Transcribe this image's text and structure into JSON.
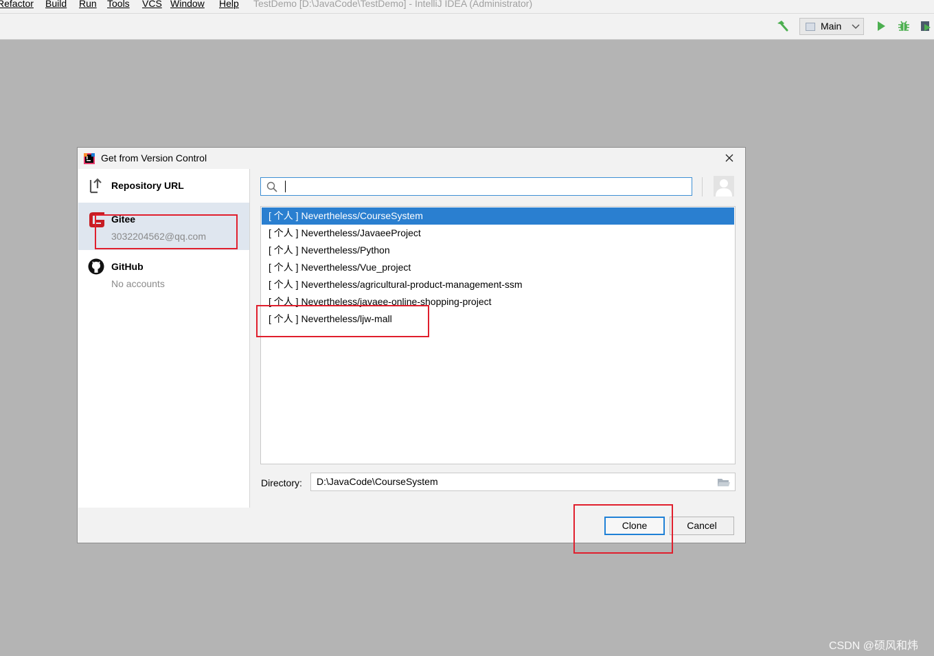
{
  "menubar": {
    "items": [
      "Refactor",
      "Build",
      "Run",
      "Tools",
      "VCS",
      "Window",
      "Help"
    ],
    "window_title": "TestDemo [D:\\JavaCode\\TestDemo] - IntelliJ IDEA (Administrator)"
  },
  "toolbar": {
    "build_icon": "hammer-icon",
    "run_config_label": "Main",
    "run_icon": "run-icon",
    "debug_icon": "debug-icon",
    "coverage_icon": "coverage-icon"
  },
  "dialog": {
    "title": "Get from Version Control",
    "sidebar": [
      {
        "label": "Repository URL",
        "sub": "",
        "icon": "vcs-branch-icon"
      },
      {
        "label": "Gitee",
        "sub": "3032204562@qq.com",
        "icon": "gitee-icon",
        "selected": true
      },
      {
        "label": "GitHub",
        "sub": "No accounts",
        "icon": "github-icon"
      }
    ],
    "search": {
      "value": "",
      "placeholder": ""
    },
    "repos": [
      {
        "tag": "[ 个人 ]",
        "name": "Nevertheless/CourseSystem",
        "selected": true
      },
      {
        "tag": "[ 个人 ]",
        "name": "Nevertheless/JavaeeProject"
      },
      {
        "tag": "[ 个人 ]",
        "name": "Nevertheless/Python"
      },
      {
        "tag": "[ 个人 ]",
        "name": "Nevertheless/Vue_project"
      },
      {
        "tag": "[ 个人 ]",
        "name": "Nevertheless/agricultural-product-management-ssm"
      },
      {
        "tag": "[ 个人 ]",
        "name": "Nevertheless/javaee-online-shopping-project"
      },
      {
        "tag": "[ 个人 ]",
        "name": "Nevertheless/ljw-mall"
      }
    ],
    "directory_label": "Directory:",
    "directory_value": "D:\\JavaCode\\CourseSystem",
    "clone_label": "Clone",
    "cancel_label": "Cancel"
  },
  "colors": {
    "selection": "#2a7fd0",
    "annotation": "#e01e2c",
    "focus": "#1e80d6",
    "gitee": "#c71d23",
    "run_green": "#4caf50"
  },
  "watermark": "CSDN @硕风和炜"
}
